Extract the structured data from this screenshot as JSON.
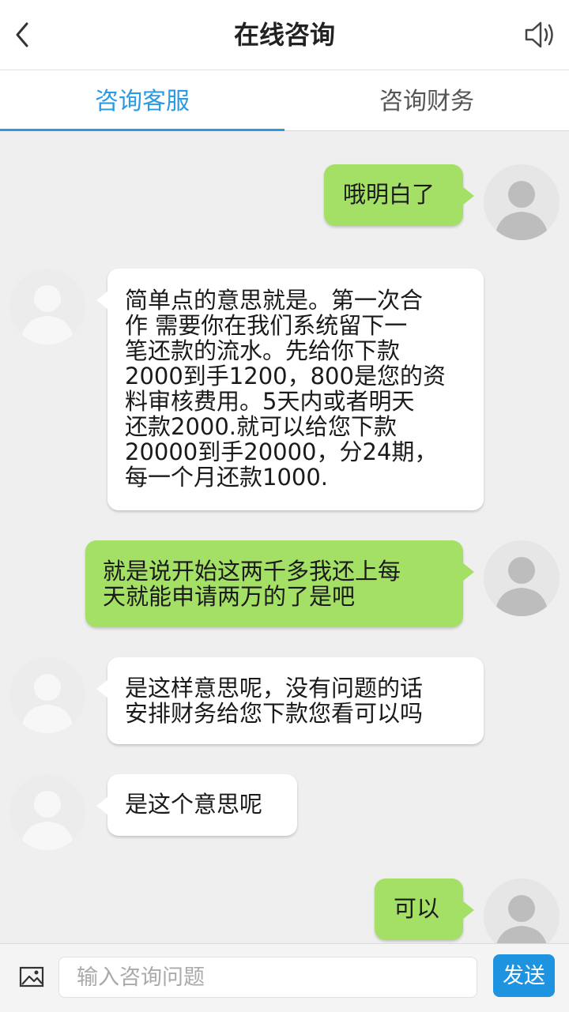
{
  "header": {
    "title": "在线咨询",
    "back_icon": "chevron-left-icon",
    "speaker_icon": "speaker-icon"
  },
  "tabs": [
    {
      "label": "咨询客服",
      "active": true
    },
    {
      "label": "咨询财务",
      "active": false
    }
  ],
  "messages": [
    {
      "from": "me",
      "text": "哦明白了"
    },
    {
      "from": "agent",
      "text": "简单点的意思就是。第一次合\n作 需要你在我们系统留下一\n笔还款的流水。先给你下款\n2000到手1200，800是您的资\n料审核费用。5天内或者明天\n还款2000.就可以给您下款\n20000到手20000，分24期，\n每一个月还款1000."
    },
    {
      "from": "me",
      "text": "就是说开始这两千多我还上每\n天就能申请两万的了是吧"
    },
    {
      "from": "agent",
      "text": "是这样意思呢，没有问题的话\n安排财务给您下款您看可以吗"
    },
    {
      "from": "agent",
      "text": "是这个意思呢"
    },
    {
      "from": "me",
      "text": "可以"
    }
  ],
  "input": {
    "placeholder": "输入咨询问题",
    "value": "",
    "image_icon": "image-icon"
  },
  "send_label": "发送",
  "colors": {
    "accent": "#2a9be3",
    "my_bubble": "#a4e065",
    "agent_bubble": "#ffffff",
    "send_button": "#1e93e0",
    "background": "#efefef"
  }
}
